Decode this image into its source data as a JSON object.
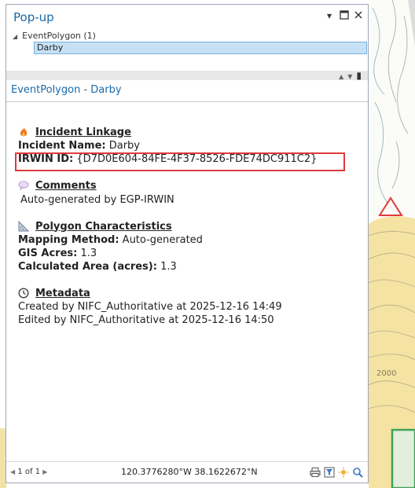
{
  "panel": {
    "title": "Pop-up",
    "tree_layer": "EventPolygon (1)",
    "tree_selected": "Darby",
    "subtitle": "EventPolygon - Darby"
  },
  "sections": {
    "incident": {
      "title": "Incident Linkage",
      "name_label": "Incident Name:",
      "name_value": "Darby",
      "irwin_label": "IRWIN ID:",
      "irwin_value": "{D7D0E604-84FE-4F37-8526-FDE74DC911C2}"
    },
    "comments": {
      "title": "Comments",
      "text": "Auto-generated by EGP-IRWIN"
    },
    "polygon": {
      "title": "Polygon Characteristics",
      "method_label": "Mapping Method:",
      "method_value": "Auto-generated",
      "acres_label": "GIS Acres:",
      "acres_value": "1.3",
      "calc_label": "Calculated Area (acres):",
      "calc_value": "1.3"
    },
    "metadata": {
      "title": "Metadata",
      "created": "Created by NIFC_Authoritative at 2025-12-16 14:49",
      "edited": "Edited by NIFC_Authoritative at 2025-12-16 14:50"
    }
  },
  "status": {
    "page": "1 of 1",
    "coordinates": "120.3776280°W 38.1622672°N"
  },
  "map": {
    "label_2000": "2000"
  },
  "colors": {
    "accent": "#1a69a8",
    "highlight_box": "#e0393b",
    "selection": "#c6e1f5"
  }
}
